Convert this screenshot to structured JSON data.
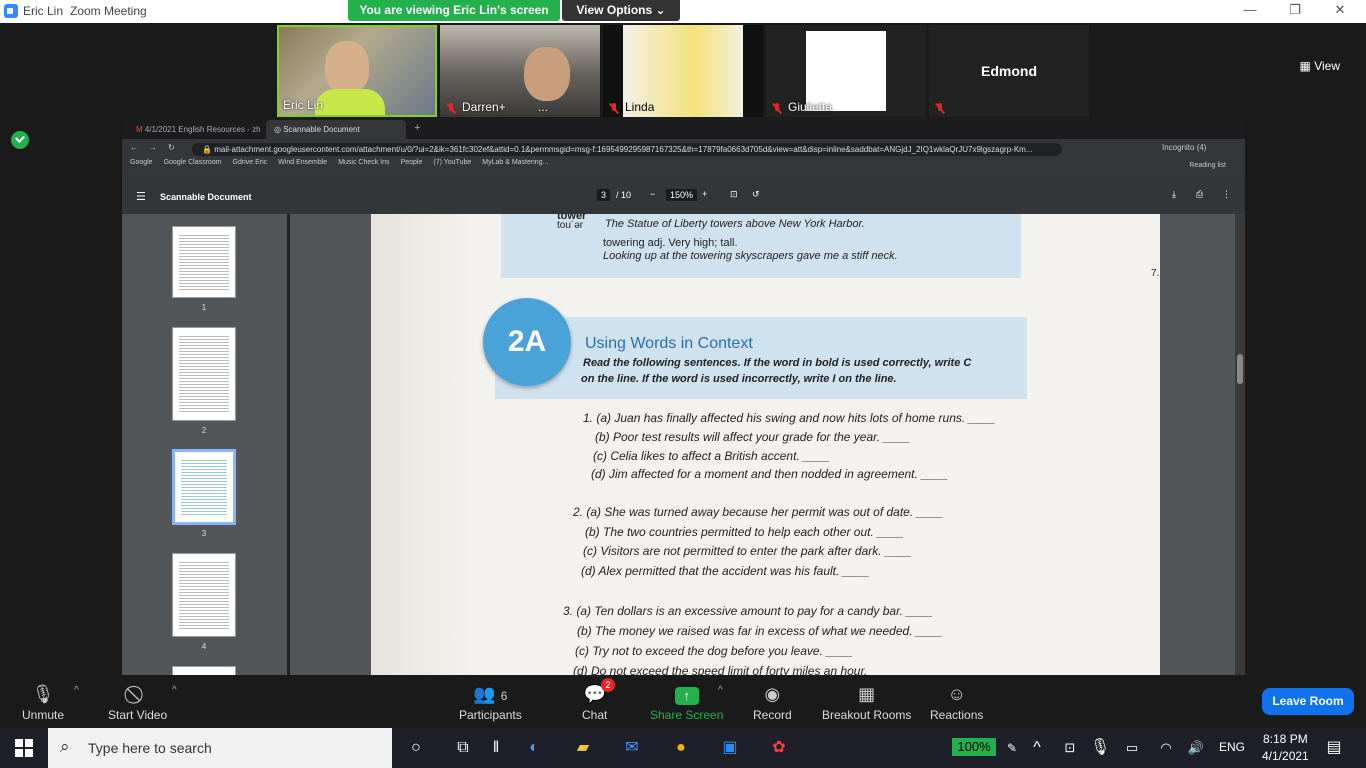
{
  "zoom": {
    "window_name": "Eric Lin",
    "app_title": "Zoom Meeting",
    "viewing_banner": "You are viewing Eric Lin's screen",
    "view_options": "View Options",
    "view_button": "View",
    "participants": [
      {
        "name": "Eric Lin"
      },
      {
        "name": "Darren+"
      },
      {
        "name": "Linda"
      },
      {
        "name": "Giulietta"
      },
      {
        "name": "Edmond"
      }
    ],
    "toolbar": {
      "unmute": "Unmute",
      "start_video": "Start Video",
      "participants": "Participants",
      "participants_count": "6",
      "chat": "Chat",
      "chat_badge": "2",
      "share_screen": "Share Screen",
      "record": "Record",
      "breakout": "Breakout Rooms",
      "reactions": "Reactions",
      "leave": "Leave Room"
    }
  },
  "browser": {
    "tabs": [
      "4/1/2021 English Resources - zh",
      "Scannable Document"
    ],
    "url": "mail-attachment.googleusercontent.com/attachment/u/0/?ui=2&ik=361fc302ef&attid=0.1&permmsgid=msg-f:1695499295987167325&th=17879fa0663d705d&view=att&disp=inline&saddbat=ANGjdJ_2IQ1wklaQrJU7x9lgszagrp-Km...",
    "incognito": "Incognito (4)",
    "reading_list": "Reading list",
    "bookmarks": [
      "Google",
      "Google Classroom",
      "Gdrive Eric",
      "Wind Ensemble",
      "Music Check Ins",
      "People",
      "(7) YouTube",
      "MyLab & Mastering..."
    ]
  },
  "pdf": {
    "title": "Scannable Document",
    "page_current": "3",
    "page_total": "/ 10",
    "zoom": "150%",
    "thumb_numbers": [
      "1",
      "2",
      "3",
      "4"
    ],
    "side_number": "7.",
    "word_pron": "tou´ər",
    "word_head": "tower",
    "lines": [
      "The Statue of Liberty towers above New York Harbor.",
      "towering   adj.  Very high; tall.",
      "Looking up at the towering skyscrapers gave me a stiff neck."
    ],
    "badge": "2A",
    "section_title": "Using Words in Context",
    "instructions": [
      "Read the following sentences. If the word in bold is used correctly, write C",
      "on the line. If the word is used incorrectly, write I on the line."
    ],
    "sentences": [
      "1. (a)  Juan has finally affected his swing and now hits lots of home runs.  ____",
      "(b)  Poor test results will affect your grade for the year.  ____",
      "(c)  Celia likes to affect a British accent.  ____",
      "(d)  Jim affected for a moment and then nodded in agreement.  ____",
      "2. (a)  She was turned away because her permit was out of date.  ____",
      "(b)  The two countries permitted to help each other out.  ____",
      "(c)  Visitors are not permitted to enter the park after dark.  ____",
      "(d)  Alex permitted that the accident was his fault.  ____",
      "3. (a)  Ten dollars is an excessive amount to pay for a candy bar.  ____",
      "(b)  The money we raised was far in excess of what we needed.  ____",
      "(c)  Try not to exceed the dog before you leave.  ____",
      "(d)  Do not exceed the speed limit of forty miles an hour.  ____"
    ]
  },
  "taskbar": {
    "search_placeholder": "Type here to search",
    "battery_pct": "100%",
    "lang": "ENG",
    "time": "8:18 PM",
    "date": "4/1/2021"
  }
}
